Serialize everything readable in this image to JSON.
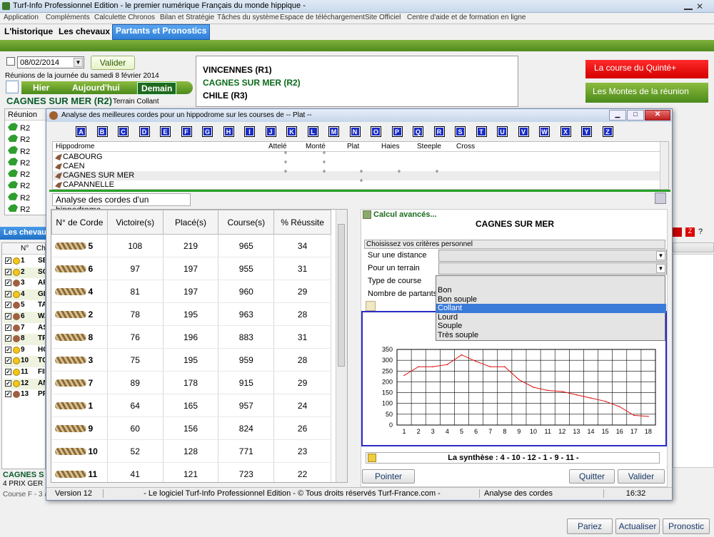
{
  "app": {
    "title": "Turf-Info Professionnel Edition - le premier numérique Français du monde hippique -"
  },
  "menu": [
    "Application",
    "Compléments",
    "Calculette Chronos",
    "Bilan et Stratégie",
    "Tâches du système",
    "Espace de téléchargement",
    "Site Officiel",
    "Centre d'aide et de formation en ligne"
  ],
  "tabs": [
    "L'historique",
    "Les chevaux",
    "Partants et Pronostics"
  ],
  "left": {
    "date": "08/02/2014",
    "valider": "Valider",
    "reunions_text": "Réunions de la journée du samedi 8 février 2014",
    "hier": "Hier",
    "aujourdhui": "Aujourd'hui",
    "demain": "Demain",
    "course_title": "CAGNES SUR MER (R2)",
    "terrain": "Terrain Collant",
    "reunion_header": "Réunion",
    "reunion_rows": [
      "R2",
      "R2",
      "R2",
      "R2",
      "R2",
      "R2",
      "R2",
      "R2"
    ],
    "chevaux_header": "Les chevaux",
    "horse_rows": [
      {
        "n": "1",
        "nom": "SE"
      },
      {
        "n": "2",
        "nom": "SO"
      },
      {
        "n": "3",
        "nom": "AF"
      },
      {
        "n": "4",
        "nom": "GL"
      },
      {
        "n": "5",
        "nom": "TA"
      },
      {
        "n": "6",
        "nom": "WA"
      },
      {
        "n": "7",
        "nom": "AS"
      },
      {
        "n": "8",
        "nom": "TR"
      },
      {
        "n": "9",
        "nom": "HC"
      },
      {
        "n": "10",
        "nom": "TC"
      },
      {
        "n": "11",
        "nom": "FIF"
      },
      {
        "n": "12",
        "nom": "AN"
      },
      {
        "n": "13",
        "nom": "PR"
      }
    ],
    "col_n": "N°",
    "col_ch": "Ch",
    "bottom1": "CAGNES S",
    "bottom2": "4 PRIX GER",
    "bottom3": "Course F - 3 a"
  },
  "hippos": [
    "VINCENNES (R1)",
    "CAGNES SUR MER (R2)",
    "CHILE (R3)"
  ],
  "right": {
    "quinte": "La course du Quinté+",
    "montes": "Les Montes de la réunion"
  },
  "bottom_buttons": [
    "Pariez",
    "Actualiser",
    "Pronostic"
  ],
  "dialog": {
    "title": "Analyse des meilleures cordes pour un hippodrome sur les courses de -- Plat --",
    "letters": [
      "A",
      "B",
      "C",
      "D",
      "E",
      "F",
      "G",
      "H",
      "I",
      "J",
      "K",
      "L",
      "M",
      "N",
      "O",
      "P",
      "Q",
      "R",
      "S",
      "T",
      "U",
      "V",
      "W",
      "X",
      "Y",
      "Z"
    ],
    "hippo_headers": [
      "Hippodrome",
      "Attelé",
      "Monté",
      "Plat",
      "Haies",
      "Steeple",
      "Cross"
    ],
    "hippo_rows": [
      {
        "name": "CABOURG",
        "attele": "°",
        "monte": "°",
        "plat": "",
        "haies": "",
        "steeple": "",
        "cross": ""
      },
      {
        "name": "CAEN",
        "attele": "°",
        "monte": "°",
        "plat": "",
        "haies": "",
        "steeple": "",
        "cross": ""
      },
      {
        "name": "CAGNES SUR MER",
        "attele": "°",
        "monte": "°",
        "plat": "°",
        "haies": "°",
        "steeple": "°",
        "cross": ""
      },
      {
        "name": "CAPANNELLE",
        "attele": "",
        "monte": "",
        "plat": "°",
        "haies": "",
        "steeple": "",
        "cross": ""
      }
    ],
    "section_tab": "Analyse des cordes d'un hippodrome",
    "corde_headers": [
      "N° de Corde",
      "Victoire(s)",
      "Placé(s)",
      "Course(s)",
      "% Réussite"
    ],
    "corde_rows": [
      [
        "5",
        "108",
        "219",
        "965",
        "34"
      ],
      [
        "6",
        "97",
        "197",
        "955",
        "31"
      ],
      [
        "4",
        "81",
        "197",
        "960",
        "29"
      ],
      [
        "2",
        "78",
        "195",
        "963",
        "28"
      ],
      [
        "8",
        "76",
        "196",
        "883",
        "31"
      ],
      [
        "3",
        "75",
        "195",
        "959",
        "28"
      ],
      [
        "7",
        "89",
        "178",
        "915",
        "29"
      ],
      [
        "1",
        "64",
        "165",
        "957",
        "24"
      ],
      [
        "9",
        "60",
        "156",
        "824",
        "26"
      ],
      [
        "10",
        "52",
        "128",
        "771",
        "23"
      ],
      [
        "11",
        "41",
        "121",
        "723",
        "22"
      ]
    ],
    "calc_label": "Calcul avancés...",
    "hippo_name": "CAGNES SUR MER",
    "criteria_header": "Choisissez vos critères personnel",
    "criteria": [
      "Sur une distance",
      "Pour un terrain",
      "Type de course",
      "Nombre de partants"
    ],
    "terrain_options": [
      "Bon",
      "Bon souple",
      "Collant",
      "Lourd",
      "Souple",
      "Très souple"
    ],
    "selected_option": "Collant",
    "synthese": "La synthèse : 4 - 10 - 12 - 1 - 9 - 11 -",
    "pointer": "Pointer",
    "quitter": "Quitter",
    "valider": "Valider",
    "status": {
      "version": "Version 12",
      "copy": "- Le logiciel Turf-Info Professionnel Edition - © Tous droits réservés Turf-France.com -",
      "section": "Analyse des cordes",
      "time": "16:32"
    }
  },
  "chart_data": {
    "type": "line",
    "x": [
      1,
      2,
      3,
      4,
      5,
      6,
      7,
      8,
      9,
      10,
      11,
      12,
      13,
      14,
      15,
      16,
      17,
      18
    ],
    "series": [
      {
        "values": [
          230,
          270,
          270,
          280,
          325,
          295,
          270,
          270,
          210,
          175,
          160,
          155,
          140,
          125,
          110,
          85,
          45,
          40
        ]
      }
    ],
    "ylim": [
      0,
      350
    ],
    "yticks": [
      0,
      50,
      100,
      150,
      200,
      250,
      300,
      350
    ],
    "grid": true,
    "color": "#e01010"
  }
}
